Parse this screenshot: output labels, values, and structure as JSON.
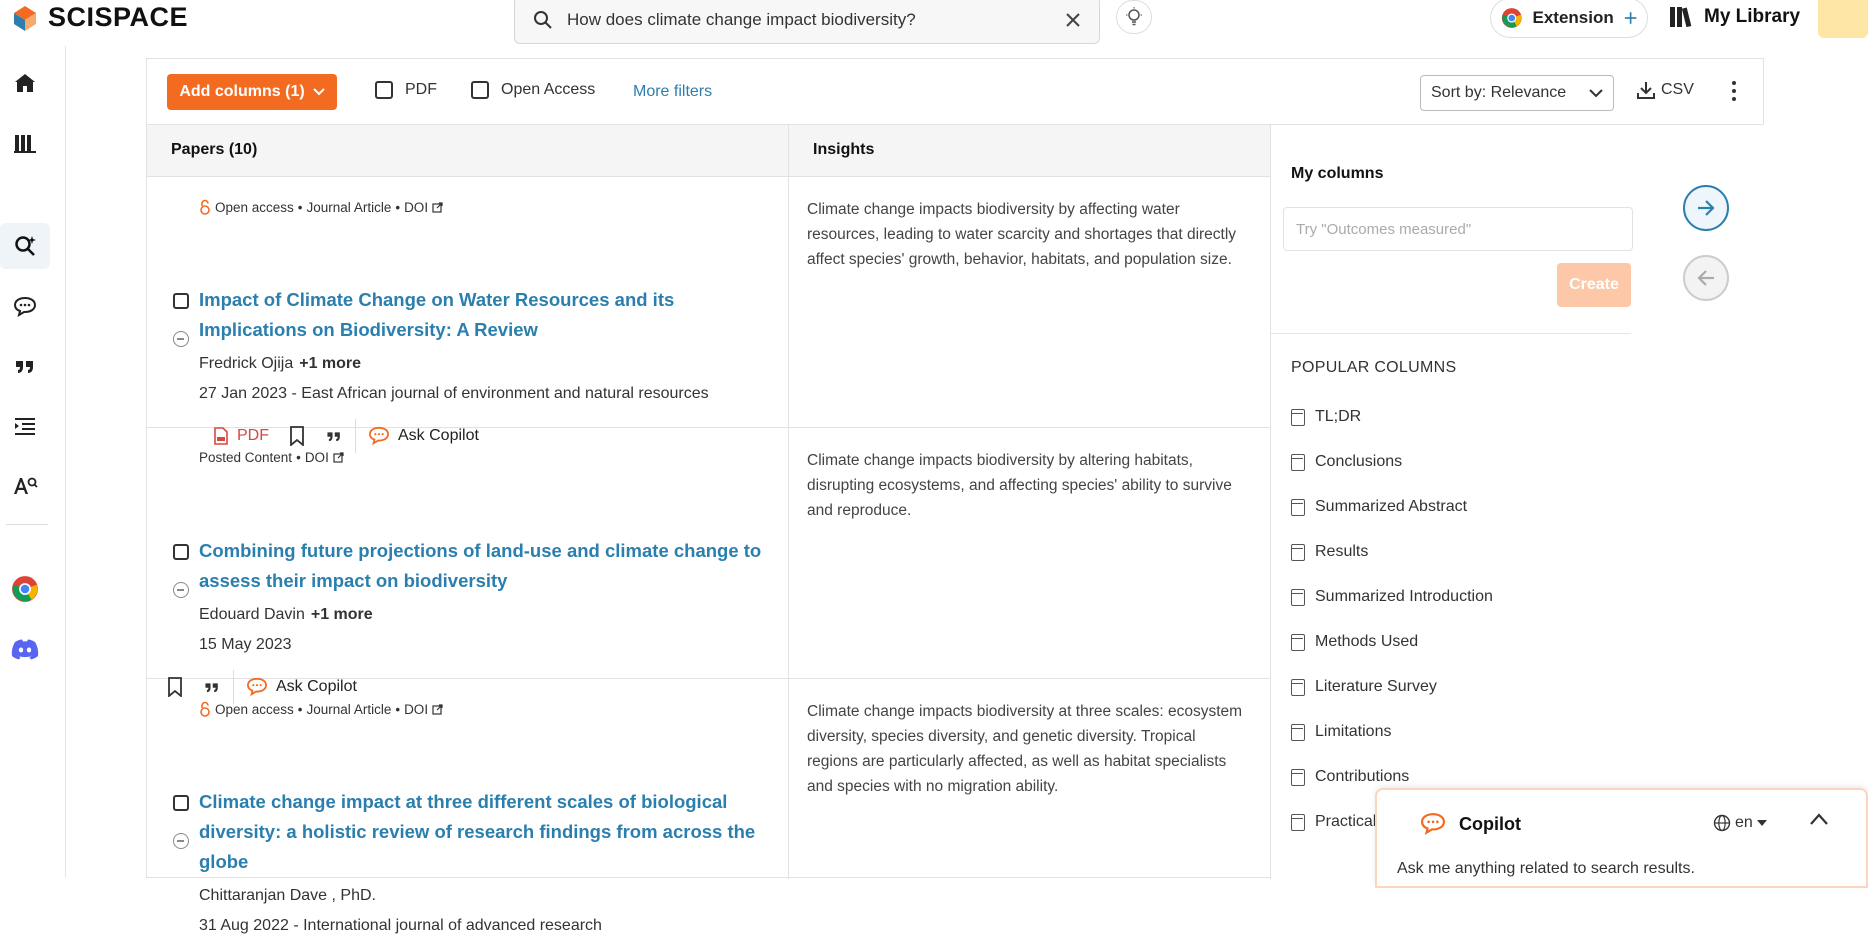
{
  "app": {
    "logo": "SCISPACE"
  },
  "search": {
    "query": "How does climate change impact biodiversity?"
  },
  "header": {
    "extension_label": "Extension",
    "library_label": "My Library"
  },
  "filters": {
    "add_columns": "Add columns (1)",
    "pdf": "PDF",
    "open_access": "Open Access",
    "more_filters": "More filters",
    "sort": "Sort by: Relevance",
    "csv": "CSV"
  },
  "table": {
    "papers_header": "Papers (10)",
    "insights_header": "Insights",
    "rows": [
      {
        "open_access": "Open access",
        "type": "Journal Article",
        "doi": "DOI",
        "title": "Impact of Climate Change on Water Resources and its Implications on Biodiversity: A Review",
        "author": "Fredrick Ojija",
        "more": "+1 more",
        "date": "27 Jan 2023",
        "venue": "East African journal of environment and natural resources",
        "pdf": "PDF",
        "ask": "Ask Copilot",
        "insight": "Climate change impacts biodiversity by affecting water resources, leading to water scarcity and shortages that directly affect species' growth, behavior, habitats, and population size."
      },
      {
        "open_access": "",
        "type": "Posted Content",
        "doi": "DOI",
        "title": "Combining future projections of land-use and climate change to assess their impact on biodiversity",
        "author": "Edouard Davin",
        "more": "+1 more",
        "date": "15 May 2023",
        "venue": "",
        "pdf": "",
        "ask": "Ask Copilot",
        "insight": "Climate change impacts biodiversity by altering habitats, disrupting ecosystems, and affecting species' ability to survive and reproduce."
      },
      {
        "open_access": "Open access",
        "type": "Journal Article",
        "doi": "DOI",
        "title": "Climate change impact at three different scales of biological diversity: a holistic review of research findings from across the globe",
        "author": "Chittaranjan Dave , PhD.",
        "more": "",
        "date": "31 Aug 2022",
        "venue": "International journal of advanced research",
        "pdf": "",
        "ask": "",
        "insight": "Climate change impacts biodiversity at three scales: ecosystem diversity, species diversity, and genetic diversity. Tropical regions are particularly affected, as well as habitat specialists and species with no migration ability."
      }
    ]
  },
  "mycolumns": {
    "title": "My columns",
    "placeholder": "Try \"Outcomes measured\"",
    "create": "Create",
    "popular_title": "POPULAR COLUMNS",
    "popular": [
      "TL;DR",
      "Conclusions",
      "Summarized Abstract",
      "Results",
      "Summarized Introduction",
      "Methods Used",
      "Literature Survey",
      "Limitations",
      "Contributions",
      "Practical"
    ]
  },
  "copilot": {
    "title": "Copilot",
    "lang": "en",
    "subtitle": "Ask me anything related to search results."
  },
  "colors": {
    "accent": "#f26b21",
    "link": "#2b7fae",
    "pdf": "#d34a3f"
  }
}
